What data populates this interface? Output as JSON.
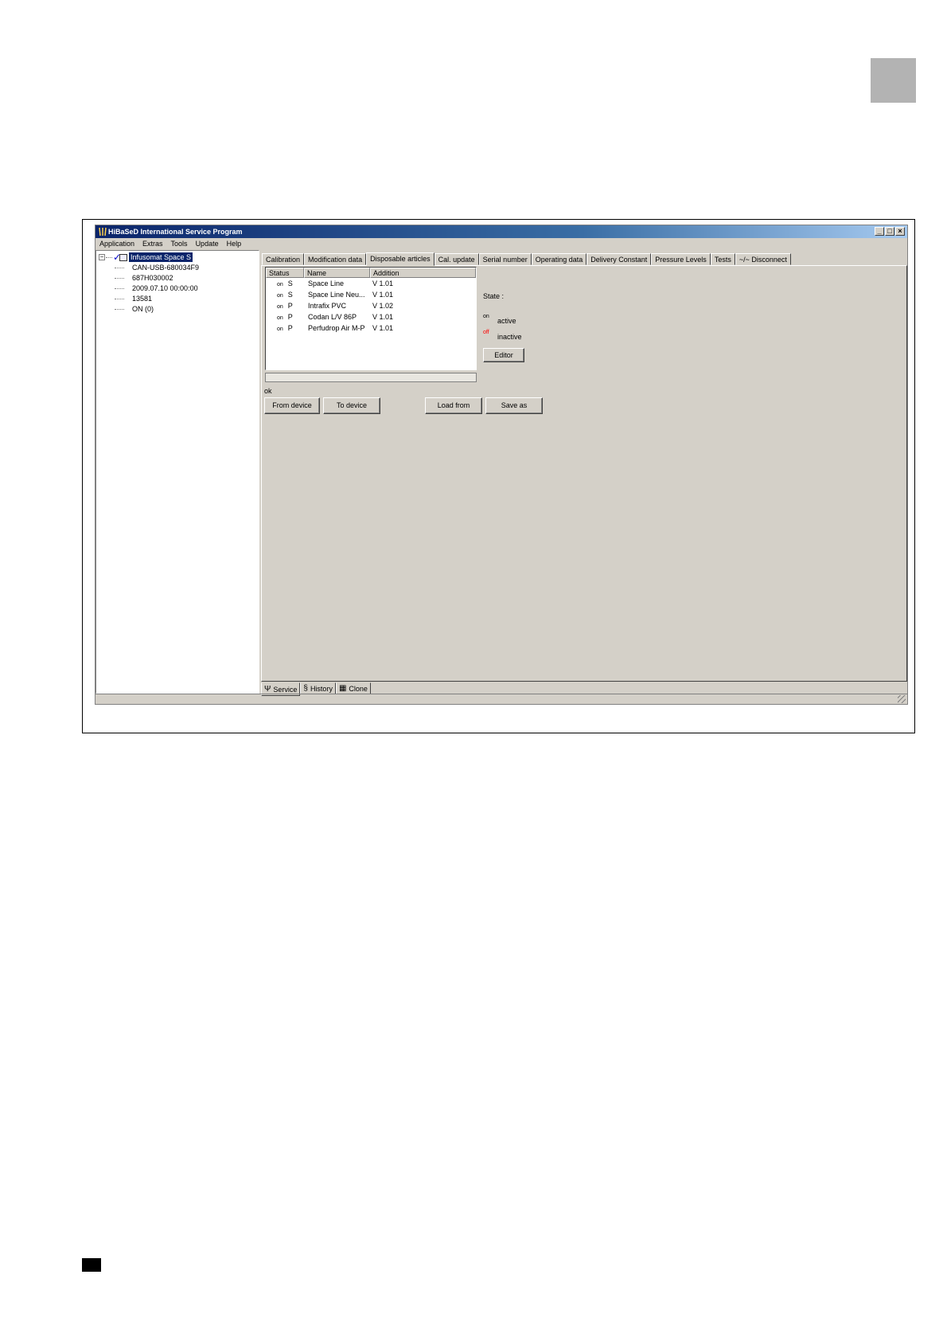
{
  "window": {
    "title": "HiBaSeD  International  Service Program",
    "controls": [
      "_",
      "□",
      "×"
    ]
  },
  "menu": [
    "Application",
    "Extras",
    "Tools",
    "Update",
    "Help"
  ],
  "tree": {
    "root_label": "Infusomat Space S",
    "root_expander": "−",
    "children": [
      "CAN-USB-680034F9",
      "687H030002",
      "2009.07.10 00:00:00",
      "13581",
      "ON (0)"
    ]
  },
  "tabs": [
    "Calibration",
    "Modification data",
    "Disposable articles",
    "Cal. update",
    "Serial number",
    "Operating data",
    "Delivery Constant",
    "Pressure Levels",
    "Tests",
    "~/~ Disconnect"
  ],
  "active_tab": "Disposable articles",
  "list": {
    "columns": [
      "Status",
      "Name",
      "Addition"
    ],
    "rows": [
      {
        "on": "on",
        "status": "S",
        "name": "Space Line",
        "addition": "V 1.01"
      },
      {
        "on": "on",
        "status": "S",
        "name": "Space Line Neu...",
        "addition": "V 1.01"
      },
      {
        "on": "on",
        "status": "P",
        "name": "Intrafix PVC",
        "addition": "V 1.02"
      },
      {
        "on": "on",
        "status": "P",
        "name": "Codan L/V 86P",
        "addition": "V 1.01"
      },
      {
        "on": "on",
        "status": "P",
        "name": "Perfudrop Air M-P",
        "addition": "V 1.01"
      }
    ]
  },
  "status_text": "ok",
  "buttons": {
    "from_device": "From device",
    "to_device": "To device",
    "load_from": "Load from",
    "save_as": "Save as",
    "editor": "Editor"
  },
  "state": {
    "label": "State :",
    "on_tag": "on",
    "active": "active",
    "off_tag": "off",
    "inactive": "inactive",
    "off_color": "#ff0000"
  },
  "bottom_tabs": [
    {
      "label": "Service",
      "icon": "service-icon"
    },
    {
      "label": "History",
      "icon": "history-icon"
    },
    {
      "label": "Clone",
      "icon": "clone-icon"
    }
  ],
  "colors": {
    "titlebar_start": "#0a246a",
    "window_bg": "#d4d0c8",
    "corner_square": "#b3b3b3"
  }
}
